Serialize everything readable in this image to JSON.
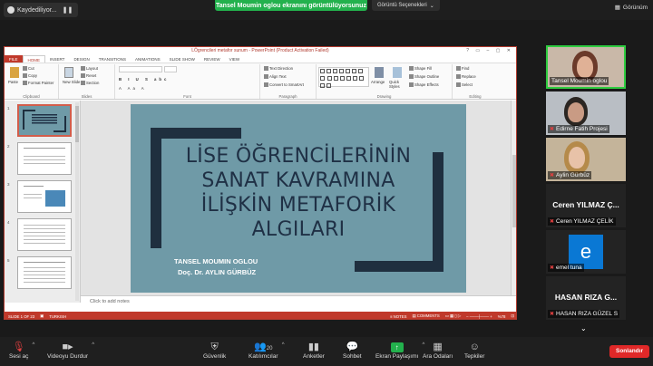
{
  "topbar": {
    "recording_label": "Kaydediliyor...",
    "share_banner": "Tansel Moumin oglou ekranını görüntülüyorsunuz",
    "view_options": "Görüntü Seçenekleri",
    "view_label": "Görünüm"
  },
  "ppt": {
    "window_title": "LÖgrencileri metafor sunum - PowerPoint (Product Activation Failed)",
    "tabs": [
      "FILE",
      "HOME",
      "INSERT",
      "DESIGN",
      "TRANSITIONS",
      "ANIMATIONS",
      "SLIDE SHOW",
      "REVIEW",
      "VIEW"
    ],
    "ribbon": {
      "paste": "Paste",
      "cut": "Cut",
      "copy": "Copy",
      "format_painter": "Format Painter",
      "clipboard": "Clipboard",
      "new_slide": "New Slide",
      "layout": "Layout",
      "reset": "Reset",
      "section": "Section",
      "slides": "Slides",
      "font": "Font",
      "text_direction": "Text Direction",
      "align_text": "Align Text",
      "convert_smartart": "Convert to SmartArt",
      "paragraph": "Paragraph",
      "arrange": "Arrange",
      "quick_styles": "Quick Styles",
      "shape_fill": "Shape Fill",
      "shape_outline": "Shape Outline",
      "shape_effects": "Shape Effects",
      "drawing": "Drawing",
      "find": "Find",
      "replace": "Replace",
      "select": "Select",
      "editing": "Editing"
    },
    "slide": {
      "title": "LİSE ÖĞRENCİLERİNİN SANAT KAVRAMINA İLİŞKİN METAFORİK ALGILARI",
      "author1": "TANSEL MOUMIN OGLOU",
      "author2": "Doç. Dr. AYLIN GÜRBÜZ"
    },
    "notes_placeholder": "Click to add notes",
    "status": {
      "slide_of": "SLIDE 1 OF 23",
      "language": "TURKISH",
      "notes": "NOTES",
      "comments": "COMMENTS",
      "zoom": "%78"
    }
  },
  "participants": [
    {
      "name": "Tansel Moumin oglou",
      "muted": false
    },
    {
      "name": "Edirne Fatih Projesi",
      "muted": true
    },
    {
      "name": "Aylin Gürbüz",
      "muted": true
    },
    {
      "name": "Ceren YILMAZ ÇELİK",
      "display": "Ceren YILMAZ Ç...",
      "muted": true
    },
    {
      "name": "emel tuna",
      "avatar": "e",
      "muted": true
    },
    {
      "name": "HASAN RIZA GÜZEL S",
      "display": "HASAN RIZA G...",
      "muted": true
    }
  ],
  "toolbar": {
    "mute": "Sesi aç",
    "video": "Videoyu Durdur",
    "security": "Güvenlik",
    "participants": "Katılımcılar",
    "participants_count": "20",
    "polls": "Anketler",
    "chat": "Sohbet",
    "share": "Ekran Paylaşımı",
    "breakout": "Ara Odaları",
    "reactions": "Tepkiler",
    "leave": "Sonlandır"
  },
  "colors": {
    "share_green": "#23b14d",
    "ppt_red": "#c0392b",
    "slide_bg": "#6f9aa7",
    "slide_dark": "#1f2f3f",
    "leave_red": "#e02828"
  }
}
